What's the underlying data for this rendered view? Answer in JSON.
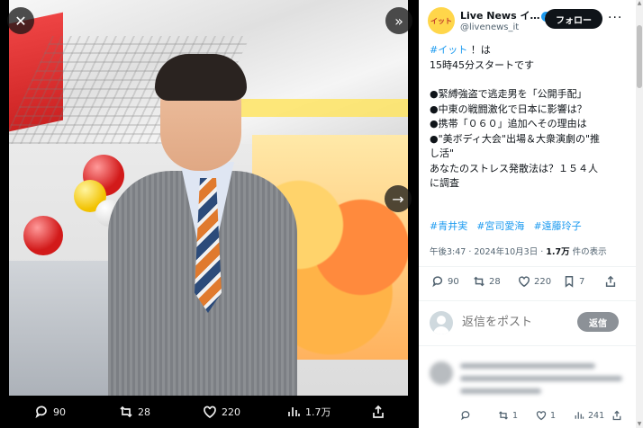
{
  "media": {
    "actions": {
      "replies": "90",
      "retweets": "28",
      "likes": "220",
      "views": "1.7万"
    }
  },
  "author": {
    "display_name": "Live News イ…",
    "handle": "@livenews_it",
    "avatar_text": "イット",
    "follow_label": "フォロー"
  },
  "tweet": {
    "hashtag_show": "#イット",
    "line1_rest": " ！は",
    "line2": "15時45分スタートです",
    "bullets": [
      "●緊縛強盗で逃走男を「公開手配」",
      "●中東の戦闘激化で日本に影響は？",
      "●携帯「０６０」追加へその理由は",
      "●\"美ボディ大会\"出場＆大衆演劇の\"推",
      "し活\"",
      "あなたのストレス発散法は？１５４人",
      "に調査"
    ],
    "tags": [
      "#青井実",
      "#宮司愛海",
      "#遠藤玲子"
    ],
    "time": "午後3:47 · 2024年10月3日 · ",
    "views_count": "1.7万",
    "views_suffix": " 件の表示"
  },
  "stats": {
    "replies": "90",
    "retweets": "28",
    "likes": "220",
    "bookmarks": "7"
  },
  "reply_box": {
    "placeholder": "返信をポスト",
    "button": "返信"
  },
  "reply_stats": {
    "replies": "1",
    "retweets": "1",
    "likes": "1",
    "views": "241"
  },
  "colors": {
    "accent": "#1d9bf0",
    "text": "#0f1419",
    "muted": "#536471"
  }
}
